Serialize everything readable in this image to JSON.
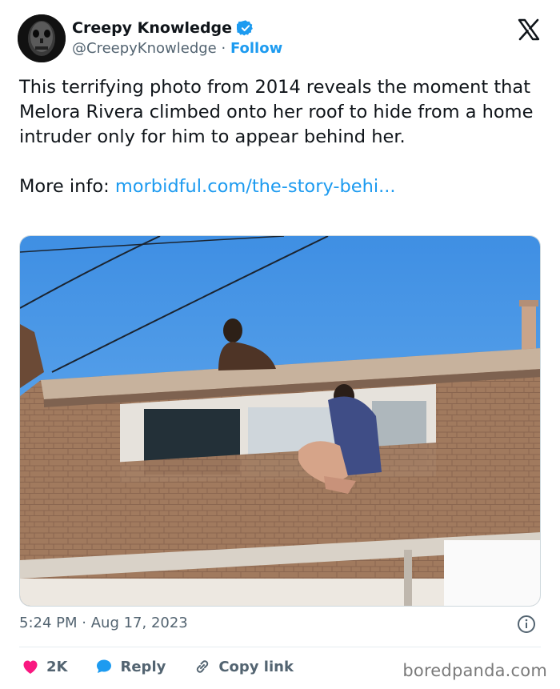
{
  "author": {
    "display_name": "Creepy Knowledge",
    "handle": "@CreepyKnowledge",
    "separator": "·",
    "follow_label": "Follow"
  },
  "tweet": {
    "text": "This terrifying photo from 2014 reveals the moment that Melora Rivera climbed onto her roof to hide from a home intruder only for him to appear behind her.",
    "more_info_label": "More info:",
    "link_text": "morbidful.com/the-story-behi..."
  },
  "meta": {
    "time": "5:24 PM",
    "separator": "·",
    "date": "Aug 17, 2023"
  },
  "actions": {
    "likes": "2K",
    "reply_label": "Reply",
    "copy_label": "Copy link"
  },
  "watermark": "boredpanda.com",
  "colors": {
    "accent": "#1d9bf0",
    "like": "#f91880",
    "text": "#0f1419",
    "muted": "#536471"
  },
  "icons": [
    "verified-badge-icon",
    "x-logo-icon",
    "info-icon",
    "heart-icon",
    "reply-bubble-icon",
    "link-icon"
  ]
}
